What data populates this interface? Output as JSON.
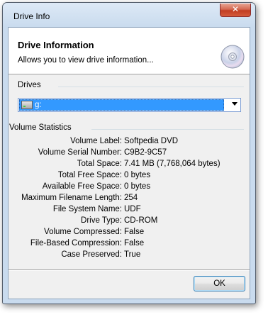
{
  "window": {
    "title": "Drive Info",
    "close_label": "✕"
  },
  "header": {
    "title": "Drive Information",
    "subtitle": "Allows you to view drive information..."
  },
  "drives": {
    "group_label": "Drives",
    "selected": "g:"
  },
  "volume_statistics": {
    "group_label": "Volume Statistics",
    "rows": [
      {
        "label": "Volume Label:",
        "value": "Softpedia DVD"
      },
      {
        "label": "Volume Serial Number:",
        "value": "C9B2-9C57"
      },
      {
        "label": "Total Space:",
        "value": "7.41 MB (7,768,064 bytes)"
      },
      {
        "label": "Total Free Space:",
        "value": "0 bytes"
      },
      {
        "label": "Available Free Space:",
        "value": "0 bytes"
      },
      {
        "label": "Maximum Filename Length:",
        "value": "254"
      },
      {
        "label": "File System Name:",
        "value": "UDF"
      },
      {
        "label": "Drive Type:",
        "value": "CD-ROM"
      },
      {
        "label": "Volume Compressed:",
        "value": "False"
      },
      {
        "label": "File-Based Compression:",
        "value": "False"
      },
      {
        "label": "Case Preserved:",
        "value": "True"
      }
    ]
  },
  "buttons": {
    "ok_label": "OK"
  },
  "icons": {
    "disc": "cd-disc-icon",
    "drive": "optical-drive-icon",
    "dropdown": "chevron-down-icon",
    "close": "close-icon"
  },
  "colors": {
    "selection": "#3399ff",
    "close_button": "#c23d22",
    "frame": "#c9dbee"
  }
}
